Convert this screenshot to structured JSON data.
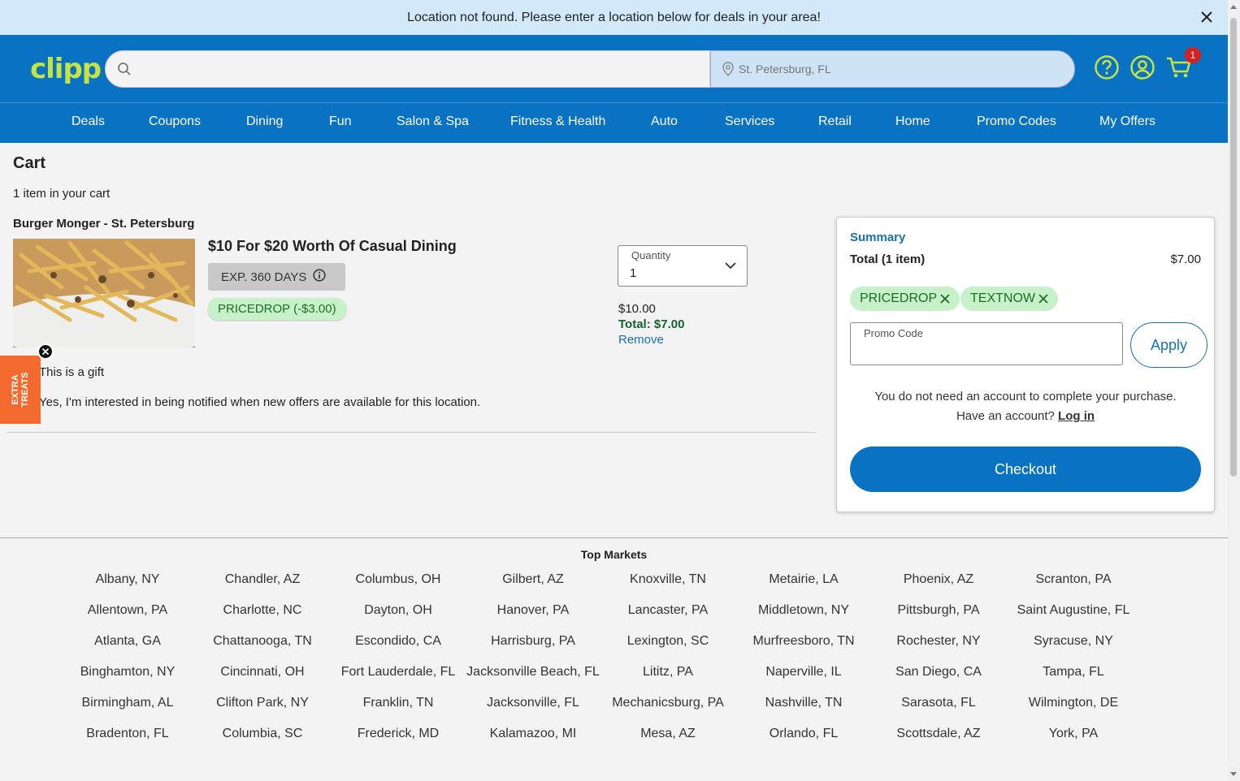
{
  "banner": {
    "message": "Location not found. Please enter a location below for deals in your area!"
  },
  "header": {
    "logo": "clipp",
    "search_placeholder": "",
    "location_placeholder": "St. Petersburg, FL",
    "cart_count": "1"
  },
  "nav": {
    "items": [
      "Deals",
      "Coupons",
      "Dining",
      "Fun",
      "Salon & Spa",
      "Fitness & Health",
      "Auto",
      "Services",
      "Retail",
      "Home",
      "Promo Codes",
      "My Offers"
    ]
  },
  "cart": {
    "title": "Cart",
    "count_text": "1 item in your cart",
    "merchant": "Burger Monger - St. Petersburg",
    "deal_title": "$10 For $20 Worth Of Casual Dining",
    "expiration": "EXP. 360 DAYS",
    "promo_badge": "PRICEDROP (-$3.00)",
    "quantity_label": "Quantity",
    "quantity_value": "1",
    "price": "$10.00",
    "total": "Total: $7.00",
    "remove": "Remove",
    "gift_text": "This is a gift",
    "notify_text": "Yes, I'm interested in being notified when new offers are available for this location.",
    "extra_treats": "EXTRA TREATS"
  },
  "summary": {
    "title": "Summary",
    "total_label": "Total (1 item)",
    "total_value": "$7.00",
    "chips": [
      "PRICEDROP",
      "TEXTNOW"
    ],
    "promo_label": "Promo Code",
    "apply": "Apply",
    "no_account": "You do not need an account to complete your purchase.",
    "have_account": "Have an account?",
    "login": "Log in",
    "checkout": "Checkout"
  },
  "markets": {
    "title": "Top Markets",
    "columns": [
      [
        "Albany, NY",
        "Allentown, PA",
        "Atlanta, GA",
        "Binghamton, NY",
        "Birmingham, AL",
        "Bradenton, FL"
      ],
      [
        "Chandler, AZ",
        "Charlotte, NC",
        "Chattanooga, TN",
        "Cincinnati, OH",
        "Clifton Park, NY",
        "Columbia, SC"
      ],
      [
        "Columbus, OH",
        "Dayton, OH",
        "Escondido, CA",
        "Fort Lauderdale, FL",
        "Franklin, TN",
        "Frederick, MD"
      ],
      [
        "Gilbert, AZ",
        "Hanover, PA",
        "Harrisburg, PA",
        "Jacksonville Beach, FL",
        "Jacksonville, FL",
        "Kalamazoo, MI"
      ],
      [
        "Knoxville, TN",
        "Lancaster, PA",
        "Lexington, SC",
        "Lititz, PA",
        "Mechanicsburg, PA",
        "Mesa, AZ"
      ],
      [
        "Metairie, LA",
        "Middletown, NY",
        "Murfreesboro, TN",
        "Naperville, IL",
        "Nashville, TN",
        "Orlando, FL"
      ],
      [
        "Phoenix, AZ",
        "Pittsburgh, PA",
        "Rochester, NY",
        "San Diego, CA",
        "Sarasota, FL",
        "Scottsdale, AZ"
      ],
      [
        "Scranton, PA",
        "Saint Augustine, FL",
        "Syracuse, NY",
        "Tampa, FL",
        "Wilmington, DE",
        "York, PA"
      ]
    ]
  },
  "colors": {
    "brand_blue": "#0a72c3",
    "accent_green": "#c7e342",
    "promo_green": "#c7f1c9",
    "treats_orange": "#f26a2e"
  }
}
